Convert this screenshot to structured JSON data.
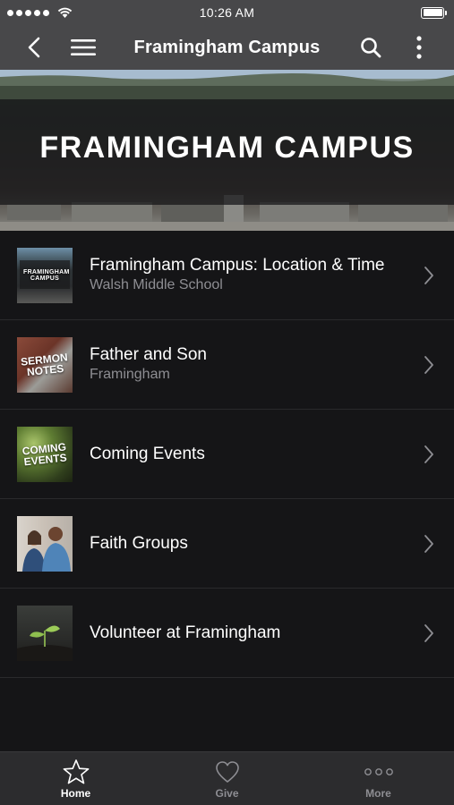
{
  "status_bar": {
    "time": "10:26 AM",
    "battery_level": 1.0
  },
  "nav": {
    "title": "Framingham Campus"
  },
  "hero": {
    "title": "FRAMINGHAM CAMPUS"
  },
  "list": [
    {
      "title": "Framingham Campus: Location & Time",
      "subtitle": "Walsh Middle School",
      "thumb_text": "FRAMINGHAM CAMPUS"
    },
    {
      "title": "Father and Son",
      "subtitle": "Framingham",
      "thumb_text": "SERMON NOTES"
    },
    {
      "title": "Coming Events",
      "thumb_text": "COMING EVENTS"
    },
    {
      "title": "Faith Groups"
    },
    {
      "title": "Volunteer at Framingham"
    }
  ],
  "tabs": [
    {
      "label": "Home",
      "icon": "star-icon",
      "active": true
    },
    {
      "label": "Give",
      "icon": "heart-icon",
      "active": false
    },
    {
      "label": "More",
      "icon": "more-icon",
      "active": false
    }
  ]
}
